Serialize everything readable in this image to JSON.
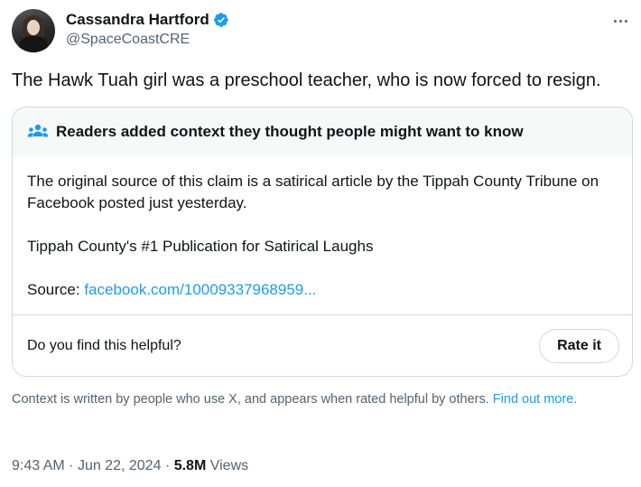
{
  "author": {
    "display_name": "Cassandra Hartford",
    "handle": "@SpaceCoastCRE",
    "verified": true
  },
  "tweet": {
    "text": "The Hawk Tuah girl was a preschool teacher, who is now forced to resign."
  },
  "community_note": {
    "header": "Readers added context they thought people might want to know",
    "paragraph_1": "The original source of this claim is a satirical article by the Tippah County Tribune on Facebook posted just yesterday.",
    "paragraph_2": "Tippah County's #1 Publication for Satirical Laughs",
    "source_label": "Source:",
    "source_link": "facebook.com/10009337968959...",
    "helpful_question": "Do you find this helpful?",
    "rate_button": "Rate it"
  },
  "context_footer": {
    "text": "Context is written by people who use X, and appears when rated helpful by others.",
    "link": "Find out more."
  },
  "meta": {
    "time": "9:43 AM",
    "date": "Jun 22, 2024",
    "views_count": "5.8M",
    "views_label": "Views"
  },
  "colors": {
    "link": "#1d9bf0",
    "secondary_text": "#536471",
    "border": "#cfd9de"
  },
  "icons": [
    "verified-badge-icon",
    "more-options-icon",
    "people-icon"
  ]
}
